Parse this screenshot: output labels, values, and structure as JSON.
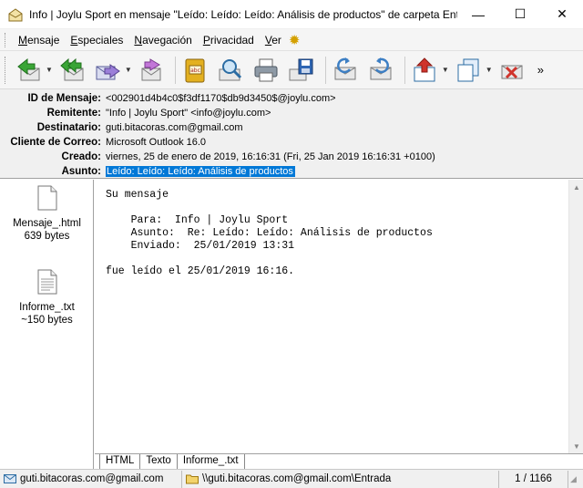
{
  "window": {
    "title": "Info | Joylu Sport en mensaje \"Leído: Leído: Leído: Análisis de productos\" de carpeta Ent...",
    "minimize": "—",
    "maximize": "☐",
    "close": "✕"
  },
  "menu": {
    "items": [
      {
        "mnemonic": "M",
        "rest": "ensaje"
      },
      {
        "mnemonic": "E",
        "rest": "speciales"
      },
      {
        "mnemonic": "N",
        "rest": "avegación"
      },
      {
        "mnemonic": "P",
        "rest": "rivacidad"
      },
      {
        "mnemonic": "V",
        "rest": "er"
      }
    ],
    "extra_icon": "gear-icon"
  },
  "toolbar": {
    "more": "»"
  },
  "headers": [
    {
      "label": "ID de Mensaje:",
      "value": "<002901d4b4c0$f3df1170$db9d3450$@joylu.com>"
    },
    {
      "label": "Remitente:",
      "value": "\"Info | Joylu Sport\" <info@joylu.com>"
    },
    {
      "label": "Destinatario:",
      "value": "guti.bitacoras.com@gmail.com"
    },
    {
      "label": "Cliente de Correo:",
      "value": "Microsoft Outlook 16.0"
    },
    {
      "label": "Creado:",
      "value": "viernes, 25 de enero de 2019, 16:16:31  (Fri, 25 Jan 2019 16:16:31 +0100)"
    },
    {
      "label": "Asunto:",
      "value": "Leído: Leído: Leído: Análisis de productos"
    }
  ],
  "attachments": [
    {
      "name": "Mensaje_.html",
      "size": "639 bytes"
    },
    {
      "name": "Informe_.txt",
      "size": "~150 bytes"
    }
  ],
  "body": {
    "lines": [
      "Su mensaje",
      "",
      "    Para:  Info | Joylu Sport",
      "    Asunto:  Re: Leído: Leído: Análisis de productos",
      "    Enviado:  25/01/2019 13:31",
      "",
      "fue leído el 25/01/2019 16:16."
    ]
  },
  "tabs": [
    {
      "label": "HTML",
      "active": true
    },
    {
      "label": "Texto",
      "active": false
    },
    {
      "label": "Informe_.txt",
      "active": false
    }
  ],
  "status": {
    "account": "guti.bitacoras.com@gmail.com",
    "folder": "\\\\guti.bitacoras.com@gmail.com\\Entrada",
    "position": "1 / 1166"
  },
  "colors": {
    "selection": "#0078d7",
    "toolbar_bg": "#f5f5f5",
    "header_bg": "#f0f0f0"
  }
}
